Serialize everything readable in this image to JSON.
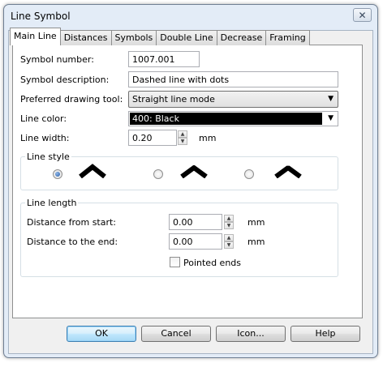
{
  "window": {
    "title": "Line Symbol",
    "close_glyph": "✕"
  },
  "tabs": [
    "Main Line",
    "Distances",
    "Symbols",
    "Double Line",
    "Decrease",
    "Framing"
  ],
  "active_tab": "Main Line",
  "fields": {
    "symbol_number": {
      "label": "Symbol number:",
      "value": "1007.001"
    },
    "symbol_description": {
      "label": "Symbol description:",
      "value": "Dashed line with dots"
    },
    "drawing_tool": {
      "label": "Preferred drawing tool:",
      "value": "Straight line mode"
    },
    "line_color": {
      "label": "Line color:",
      "value": "400: Black",
      "swatch_color": "#000000"
    },
    "line_width": {
      "label": "Line width:",
      "value": "0.20",
      "unit": "mm"
    }
  },
  "line_style": {
    "legend": "Line style",
    "options": [
      {
        "icon": "miter-join-icon",
        "checked": true
      },
      {
        "icon": "round-join-icon",
        "checked": false
      },
      {
        "icon": "bevel-join-icon",
        "checked": false
      }
    ]
  },
  "line_length": {
    "legend": "Line length",
    "distance_from_start": {
      "label": "Distance from start:",
      "value": "0.00",
      "unit": "mm"
    },
    "distance_to_end": {
      "label": "Distance to the end:",
      "value": "0.00",
      "unit": "mm"
    },
    "pointed_ends": {
      "label": "Pointed ends",
      "checked": false
    }
  },
  "buttons": {
    "ok": "OK",
    "cancel": "Cancel",
    "icon": "Icon...",
    "help": "Help"
  },
  "colors": {
    "frame": "#e3ecf7",
    "default_button_border": "#3c7fb1"
  }
}
